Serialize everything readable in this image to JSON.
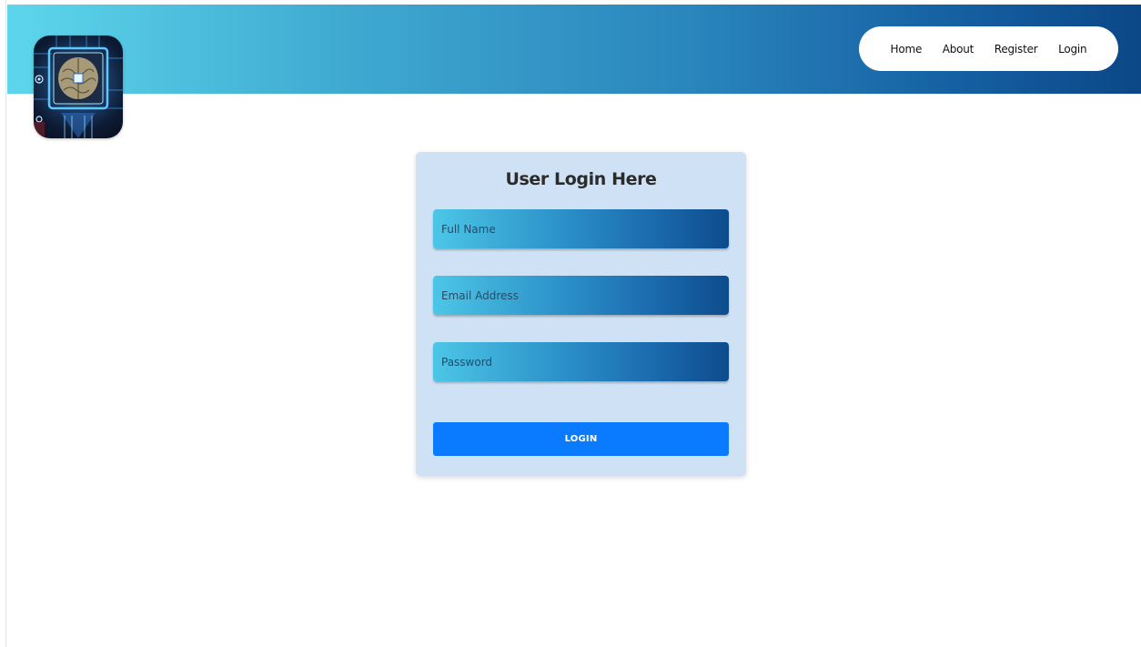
{
  "nav": {
    "items": [
      {
        "label": "Home"
      },
      {
        "label": "About"
      },
      {
        "label": "Register"
      },
      {
        "label": "Login"
      }
    ]
  },
  "login_form": {
    "title": "User Login Here",
    "full_name": {
      "placeholder": "Full Name",
      "value": ""
    },
    "email": {
      "placeholder": "Email Address",
      "value": ""
    },
    "password": {
      "placeholder": "Password",
      "value": ""
    },
    "submit_label": "LOGIN"
  },
  "colors": {
    "header_gradient_start": "#5dd6ec",
    "header_gradient_end": "#0b4787",
    "card_background": "#cfe2f5",
    "button": "#0a7bff"
  },
  "logo": {
    "icon": "ai-chip-brain-icon"
  }
}
